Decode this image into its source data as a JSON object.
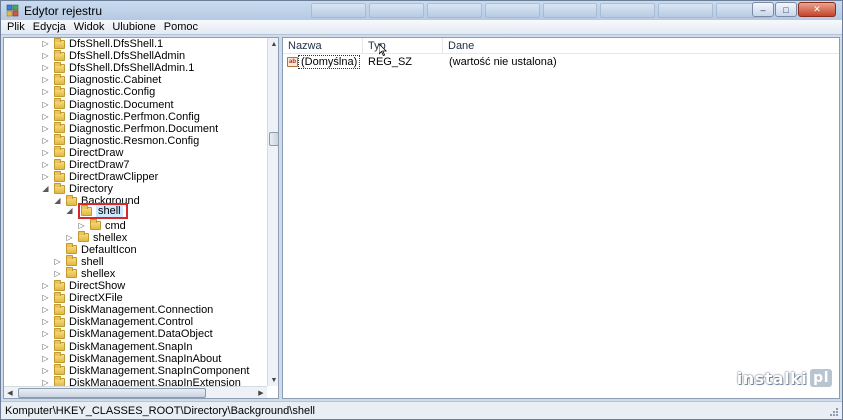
{
  "window": {
    "title": "Edytor rejestru",
    "buttons": {
      "minimize": "–",
      "maximize": "□",
      "close": "✕"
    }
  },
  "menu": [
    "Plik",
    "Edycja",
    "Widok",
    "Ulubione",
    "Pomoc"
  ],
  "tree": [
    {
      "label": "DfsShell.DfsShell.1",
      "indent": 0,
      "expander": "▷"
    },
    {
      "label": "DfsShell.DfsShellAdmin",
      "indent": 0,
      "expander": "▷"
    },
    {
      "label": "DfsShell.DfsShellAdmin.1",
      "indent": 0,
      "expander": "▷"
    },
    {
      "label": "Diagnostic.Cabinet",
      "indent": 0,
      "expander": "▷"
    },
    {
      "label": "Diagnostic.Config",
      "indent": 0,
      "expander": "▷"
    },
    {
      "label": "Diagnostic.Document",
      "indent": 0,
      "expander": "▷"
    },
    {
      "label": "Diagnostic.Perfmon.Config",
      "indent": 0,
      "expander": "▷"
    },
    {
      "label": "Diagnostic.Perfmon.Document",
      "indent": 0,
      "expander": "▷"
    },
    {
      "label": "Diagnostic.Resmon.Config",
      "indent": 0,
      "expander": "▷"
    },
    {
      "label": "DirectDraw",
      "indent": 0,
      "expander": "▷"
    },
    {
      "label": "DirectDraw7",
      "indent": 0,
      "expander": "▷"
    },
    {
      "label": "DirectDrawClipper",
      "indent": 0,
      "expander": "▷"
    },
    {
      "label": "Directory",
      "indent": 0,
      "expander": "◢"
    },
    {
      "label": "Background",
      "indent": 1,
      "expander": "◢"
    },
    {
      "label": "shell",
      "indent": 2,
      "expander": "◢",
      "selected": true
    },
    {
      "label": "cmd",
      "indent": 3,
      "expander": "▷"
    },
    {
      "label": "shellex",
      "indent": 2,
      "expander": "▷"
    },
    {
      "label": "DefaultIcon",
      "indent": 1,
      "expander": ""
    },
    {
      "label": "shell",
      "indent": 1,
      "expander": "▷"
    },
    {
      "label": "shellex",
      "indent": 1,
      "expander": "▷"
    },
    {
      "label": "DirectShow",
      "indent": 0,
      "expander": "▷"
    },
    {
      "label": "DirectXFile",
      "indent": 0,
      "expander": "▷"
    },
    {
      "label": "DiskManagement.Connection",
      "indent": 0,
      "expander": "▷"
    },
    {
      "label": "DiskManagement.Control",
      "indent": 0,
      "expander": "▷"
    },
    {
      "label": "DiskManagement.DataObject",
      "indent": 0,
      "expander": "▷"
    },
    {
      "label": "DiskManagement.SnapIn",
      "indent": 0,
      "expander": "▷"
    },
    {
      "label": "DiskManagement.SnapInAbout",
      "indent": 0,
      "expander": "▷"
    },
    {
      "label": "DiskManagement.SnapInComponent",
      "indent": 0,
      "expander": "▷"
    },
    {
      "label": "DiskManagement.SnapInExtension",
      "indent": 0,
      "expander": "▷"
    }
  ],
  "list": {
    "columns": [
      "Nazwa",
      "Typ",
      "Dane"
    ],
    "rows": [
      {
        "name": "(Domyślna)",
        "type": "REG_SZ",
        "data": "(wartość nie ustalona)",
        "icon": "ab"
      }
    ]
  },
  "status": {
    "path": "Komputer\\HKEY_CLASSES_ROOT\\Directory\\Background\\shell"
  },
  "watermark": {
    "text": "instalki",
    "badge": "pl"
  }
}
